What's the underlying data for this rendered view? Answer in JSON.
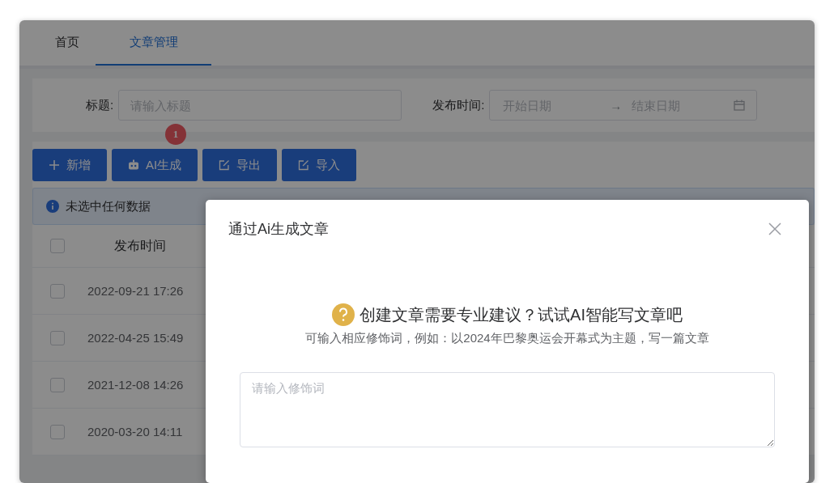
{
  "tabs": [
    {
      "label": "首页",
      "selected": false
    },
    {
      "label": "文章管理",
      "selected": true
    }
  ],
  "filters": [
    {
      "kind": "text",
      "label": "标题:",
      "placeholder": "请输入标题"
    },
    {
      "kind": "daterange",
      "label": "发布时间:",
      "start_placeholder": "开始日期",
      "separator": "→",
      "end_placeholder": "结束日期"
    }
  ],
  "toolbar": [
    {
      "kind": "plus",
      "label": "新增"
    },
    {
      "kind": "robot",
      "label": "AI生成",
      "badge": "1"
    },
    {
      "kind": "edit",
      "label": "导出"
    },
    {
      "kind": "edit",
      "label": "导入"
    }
  ],
  "alert": {
    "text": "未选中任何数据"
  },
  "table": {
    "all_checked": false,
    "columns": [
      "发布时间"
    ],
    "rows": [
      {
        "checked": false,
        "cells": [
          "2022-09-21 17:26"
        ]
      },
      {
        "checked": false,
        "cells": [
          "2022-04-25 15:49"
        ]
      },
      {
        "checked": false,
        "cells": [
          "2021-12-08 14:26"
        ]
      },
      {
        "checked": false,
        "cells": [
          "2020-03-20 14:11"
        ]
      }
    ]
  },
  "modal": {
    "title": "通过Ai生成文章",
    "heading": "创建文章需要专业建议？试试AI智能写文章吧",
    "hint": "可输入相应修饰词，例如：以2024年巴黎奥运会开幕式为主题，写一篇文章",
    "textarea": {
      "placeholder": "请输入修饰词"
    }
  }
}
